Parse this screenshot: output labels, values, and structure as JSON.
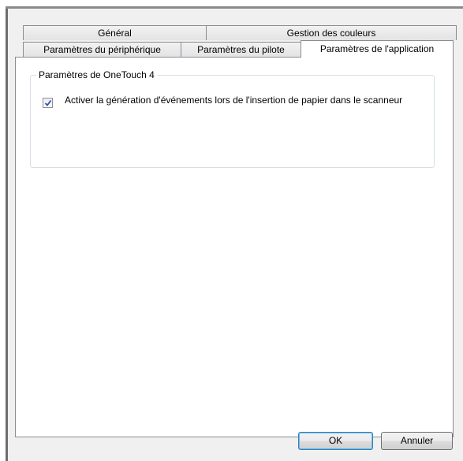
{
  "tabs": {
    "row1": [
      {
        "label": "Général"
      },
      {
        "label": "Gestion des couleurs"
      }
    ],
    "row2": [
      {
        "label": "Paramètres du périphérique"
      },
      {
        "label": "Paramètres du pilote"
      },
      {
        "label": "Paramètres de l'application",
        "active": true
      }
    ]
  },
  "group": {
    "title": "Paramètres de OneTouch 4",
    "checkbox_label": "Activer la génération d'événements lors de l'insertion de papier dans le scanneur",
    "checkbox_checked": true
  },
  "buttons": {
    "ok": "OK",
    "cancel": "Annuler"
  },
  "colors": {
    "dialog_bg": "#f0f0f0",
    "panel_bg": "#ffffff",
    "tab_border": "#898c95",
    "check_mark": "#3c4f9b"
  }
}
